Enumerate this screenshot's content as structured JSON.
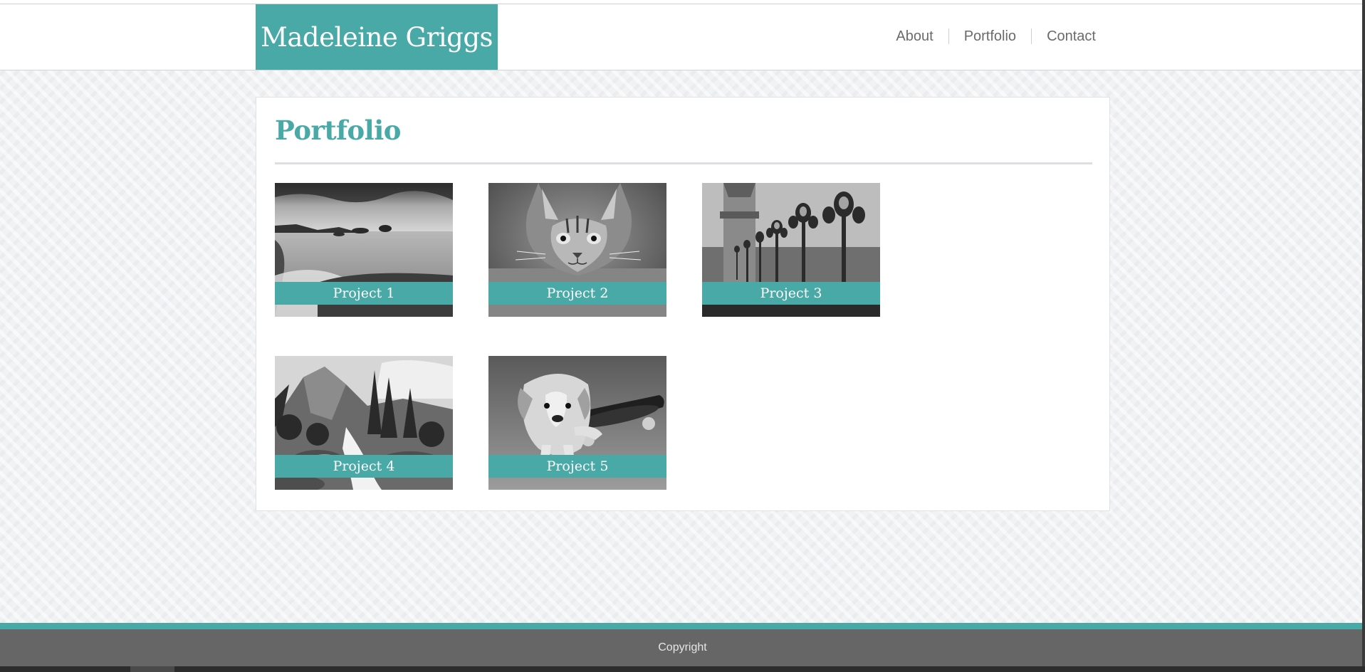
{
  "brand": {
    "title": "Madeleine Griggs"
  },
  "nav": {
    "items": [
      "About",
      "Portfolio",
      "Contact"
    ]
  },
  "page": {
    "title": "Portfolio"
  },
  "projects": [
    {
      "label": "Project 1",
      "image": "seascape-photo"
    },
    {
      "label": "Project 2",
      "image": "cat-photo"
    },
    {
      "label": "Project 3",
      "image": "street-lamps-photo"
    },
    {
      "label": "Project 4",
      "image": "mountain-stream-photo"
    },
    {
      "label": "Project 5",
      "image": "puppy-skateboard-photo"
    }
  ],
  "footer": {
    "text": "Copyright"
  },
  "colors": {
    "accent": "#49a9a6",
    "footer": "#666666",
    "nav_text": "#6a6a6a"
  }
}
